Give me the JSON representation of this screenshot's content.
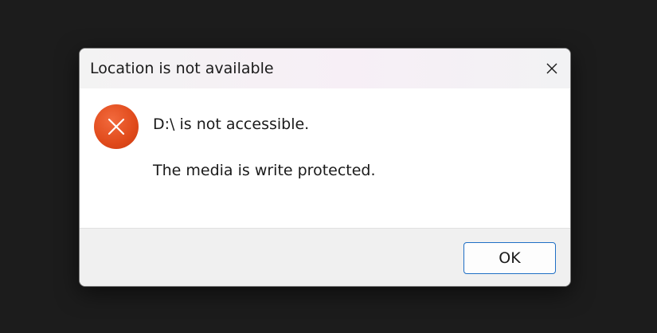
{
  "dialog": {
    "title": "Location is not available",
    "close_icon": "close-icon",
    "error_icon": "error-x-icon",
    "message_line_1": "D:\\ is not accessible.",
    "message_line_2": "The media is write protected.",
    "ok_label": "OK"
  },
  "colors": {
    "error_accent": "#e04a1b",
    "button_border": "#1f6fc5",
    "background": "#1c1c1c"
  }
}
